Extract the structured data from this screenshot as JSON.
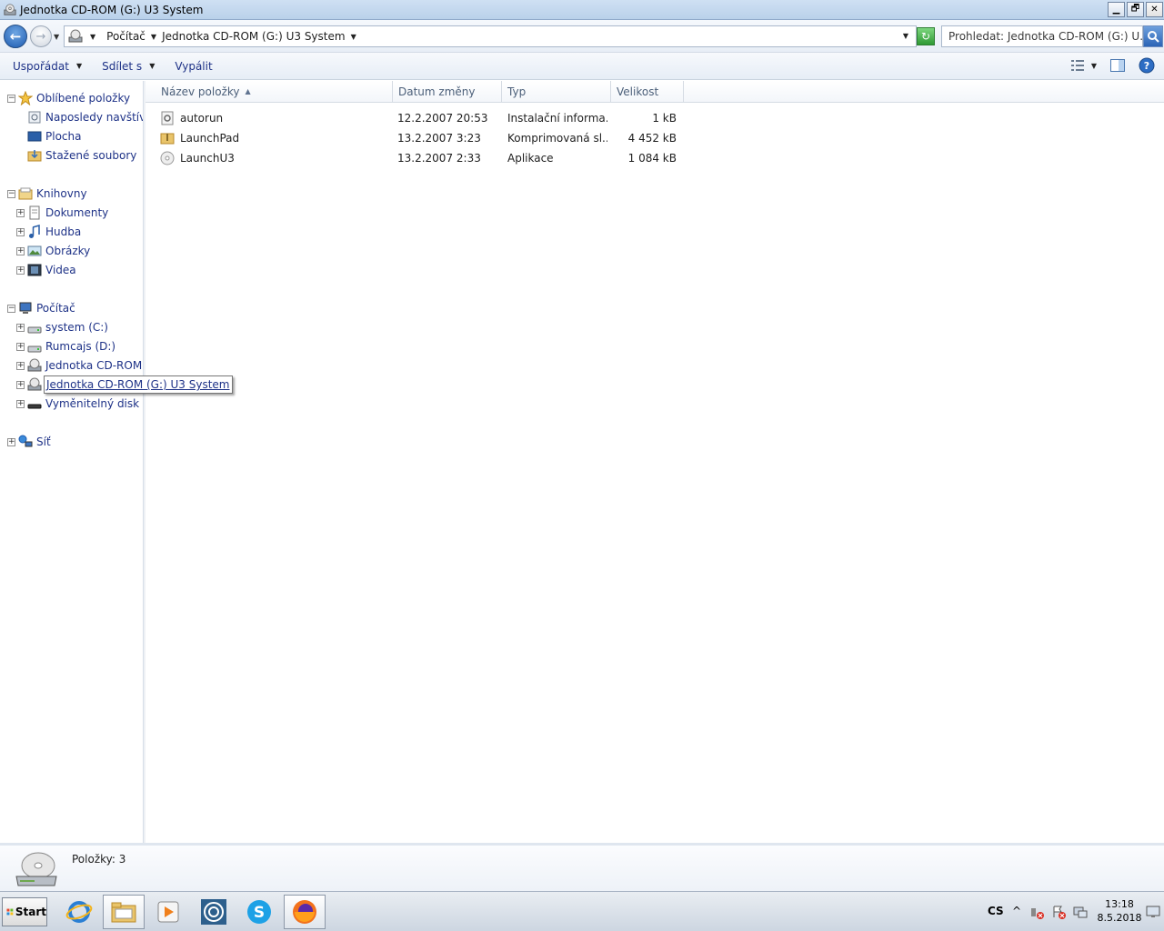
{
  "window": {
    "title": "Jednotka CD-ROM (G:) U3 System",
    "controls": {
      "minimize": "▁",
      "restore": "🗗",
      "close": "✕"
    }
  },
  "address": {
    "crumbs": [
      "Počítač",
      "Jednotka CD-ROM (G:) U3 System"
    ],
    "search_placeholder": "Prohledat: Jednotka CD-ROM (G:) U..."
  },
  "toolbar": {
    "organize": "Uspořádat",
    "share": "Sdílet s",
    "burn": "Vypálit"
  },
  "nav": {
    "favorites": {
      "label": "Oblíbené položky",
      "items": [
        "Naposledy navštíven",
        "Plocha",
        "Stažené soubory"
      ]
    },
    "libraries": {
      "label": "Knihovny",
      "items": [
        "Dokumenty",
        "Hudba",
        "Obrázky",
        "Videa"
      ]
    },
    "computer": {
      "label": "Počítač",
      "items": [
        "system (C:)",
        "Rumcajs (D:)",
        "Jednotka CD-ROM (",
        "Jednotka CD-ROM (G:) U3 System",
        "Vyměnitelný disk (H"
      ]
    },
    "network": {
      "label": "Síť"
    }
  },
  "columns": [
    "Název položky",
    "Datum změny",
    "Typ",
    "Velikost"
  ],
  "files": [
    {
      "name": "autorun",
      "date": "12.2.2007 20:53",
      "type": "Instalační informa...",
      "size": "1 kB",
      "icon": "settings-file-icon"
    },
    {
      "name": "LaunchPad",
      "date": "13.2.2007 3:23",
      "type": "Komprimovaná sl...",
      "size": "4 452 kB",
      "icon": "zip-folder-icon"
    },
    {
      "name": "LaunchU3",
      "date": "13.2.2007 2:33",
      "type": "Aplikace",
      "size": "1 084 kB",
      "icon": "u3-app-icon"
    }
  ],
  "details": {
    "count": "Položky: 3"
  },
  "taskbar": {
    "start": "Start",
    "language": "CS",
    "tray_up": "^",
    "time": "13:18",
    "date": "8.5.2018"
  },
  "colors": {
    "link": "#1e3287",
    "accent": "#1d5bb0"
  }
}
